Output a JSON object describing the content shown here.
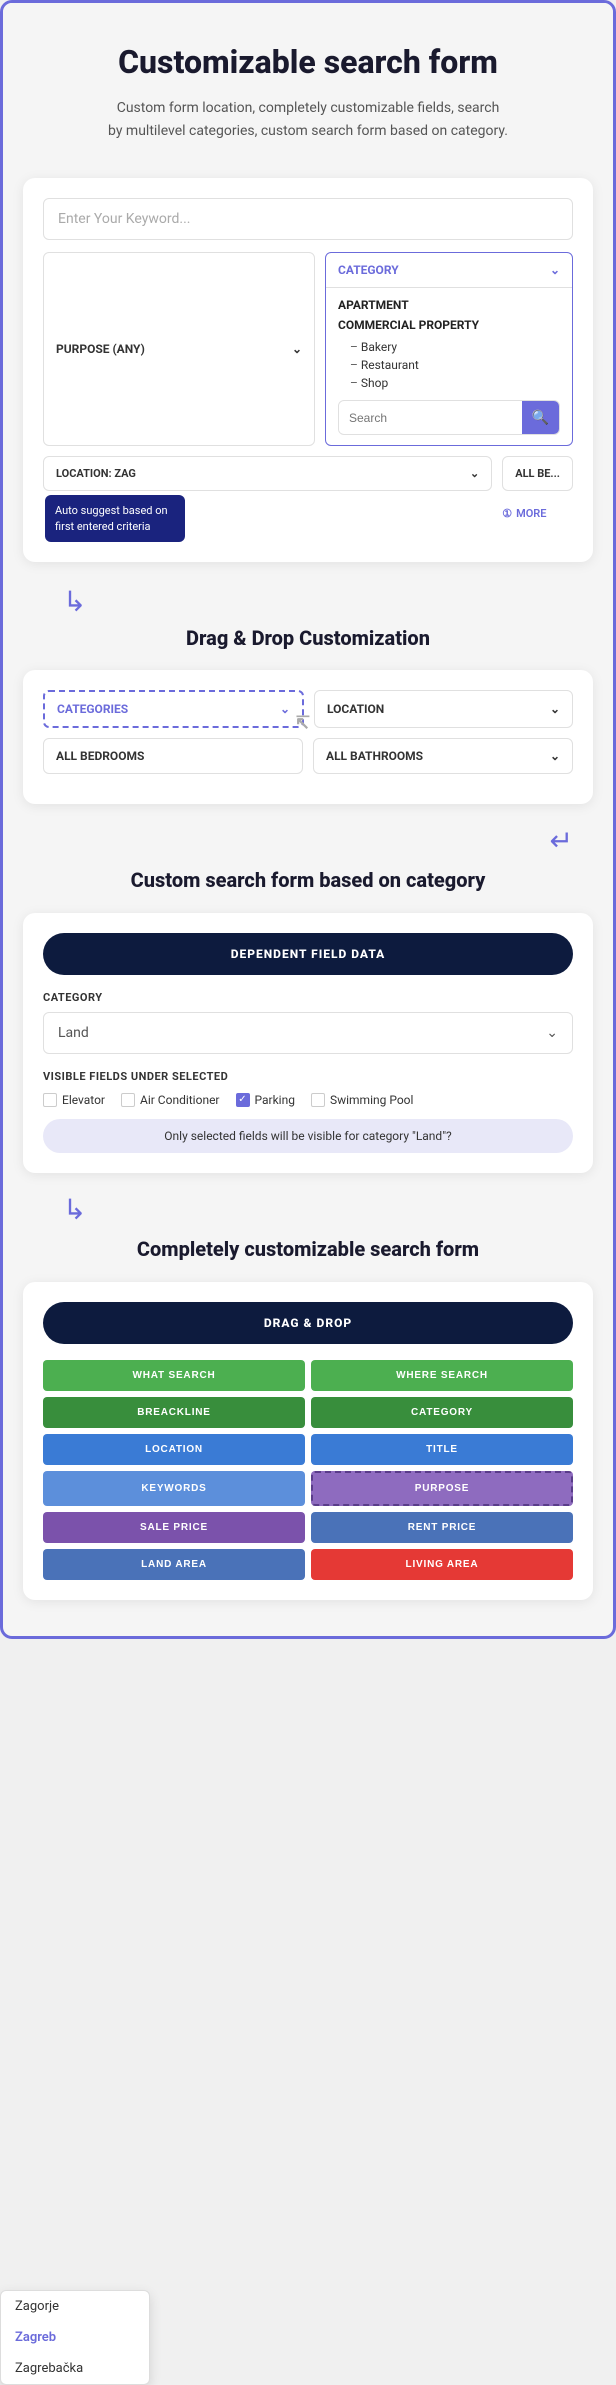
{
  "hero": {
    "title": "Customizable search form",
    "description": "Custom form location, completely customizable fields, search by multilevel categories, custom search form based on category."
  },
  "search_form": {
    "keyword_placeholder": "Enter Your Keyword...",
    "purpose_label": "PURPOSE (ANY)",
    "category_label": "CATEGORY",
    "location_label": "LOCATION: ZAG",
    "all_bedrooms_label": "ALL BE...",
    "more_label": "MORE",
    "categories": {
      "apartment_label": "APARTMENT",
      "commercial_label": "COMMERCIAL PROPERTY",
      "sub_items": [
        "Bakery",
        "Restaurant",
        "Shop"
      ]
    },
    "search_placeholder": "Search",
    "location_items": [
      "Zagorje",
      "Zagreb",
      "Zagrebačka"
    ],
    "tooltip": "Auto suggest based on first entered criteria"
  },
  "section1": {
    "title": "Drag & Drop Customization"
  },
  "drag_drop": {
    "categories_label": "CATEGORIES",
    "location_label": "LOCATION",
    "all_bedrooms_label": "ALL BEDROOMS",
    "all_bathrooms_label": "ALL BATHROOMS"
  },
  "section2": {
    "title": "Custom search form based on category"
  },
  "dependent_field": {
    "btn_label": "DEPENDENT FIELD DATA",
    "category_label": "CATEGORY",
    "category_value": "Land",
    "visible_fields_label": "VISIBLE FIELDS UNDER SELECTED",
    "fields": [
      {
        "name": "Elevator",
        "checked": false
      },
      {
        "name": "Air Conditioner",
        "checked": false
      },
      {
        "name": "Parking",
        "checked": true
      },
      {
        "name": "Swimming Pool",
        "checked": false
      }
    ],
    "info_text": "Only selected fields will be visible for category \"Land\"?"
  },
  "section3": {
    "title": "Completely customizable search form"
  },
  "drag_drop2": {
    "btn_label": "DRAG & DROP",
    "what_search": "WHAT SEARCH",
    "where_search": "WHERE SEARCH",
    "breackline": "BREACKLINE",
    "category": "CATEGORY",
    "location": "LOCATION",
    "title": "TITLE",
    "keywords": "KEYWORDS",
    "purpose": "PURPOSE",
    "sale_price": "SALE PRICE",
    "rent_price": "RENT PRICE",
    "land_area": "LAND AREA",
    "living_area": "LIVING AREA"
  }
}
